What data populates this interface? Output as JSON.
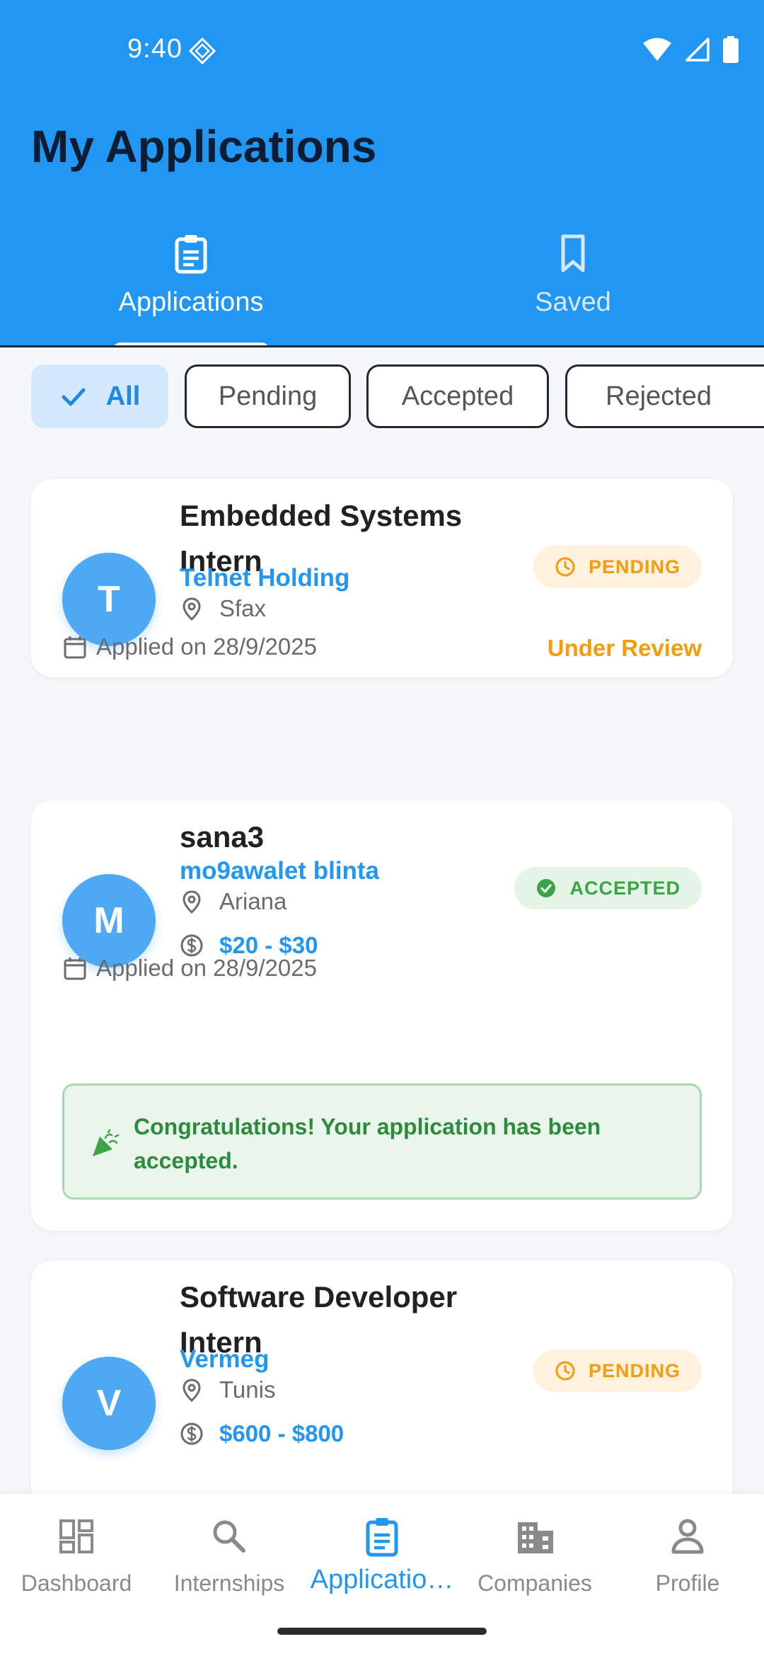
{
  "status_bar": {
    "time": "9:40"
  },
  "header": {
    "title": "My Applications",
    "tabs": [
      {
        "label": "Applications",
        "icon": "clipboard-icon",
        "active": true
      },
      {
        "label": "Saved",
        "icon": "bookmark-icon",
        "active": false
      }
    ]
  },
  "filters": {
    "chips": [
      {
        "label": "All",
        "selected": true
      },
      {
        "label": "Pending",
        "selected": false
      },
      {
        "label": "Accepted",
        "selected": false
      },
      {
        "label": "Rejected",
        "selected": false
      }
    ]
  },
  "applications": [
    {
      "avatar_letter": "T",
      "title_line1": "Embedded Systems",
      "title_line2": "Intern",
      "company": "Telnet Holding",
      "location": "Sfax",
      "status": "PENDING",
      "applied": "Applied on 28/9/2025",
      "review_status": "Under Review"
    },
    {
      "avatar_letter": "M",
      "title_line1": "sana3",
      "company": "mo9awalet blinta",
      "location": "Ariana",
      "salary": "$20 - $30",
      "status": "ACCEPTED",
      "applied": "Applied on 28/9/2025",
      "congrats": "Congratulations! Your application has been accepted."
    },
    {
      "avatar_letter": "V",
      "title_line1": "Software Developer",
      "title_line2": "Intern",
      "company": "Vermeg",
      "location": "Tunis",
      "salary": "$600 - $800",
      "status": "PENDING"
    }
  ],
  "bottom_nav": [
    {
      "label": "Dashboard",
      "icon": "dashboard-icon"
    },
    {
      "label": "Internships",
      "icon": "search-icon"
    },
    {
      "label": "Applicatio…",
      "icon": "clipboard-icon",
      "active": true
    },
    {
      "label": "Companies",
      "icon": "building-icon"
    },
    {
      "label": "Profile",
      "icon": "person-icon"
    }
  ],
  "colors": {
    "primary": "#2196F3",
    "pending": "#F59C0B",
    "accepted": "#3BA44A"
  }
}
